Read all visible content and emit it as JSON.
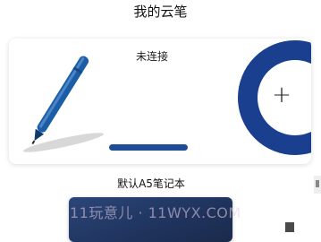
{
  "header": {
    "title": "我的云笔"
  },
  "pen_card": {
    "status": "未连接",
    "add_icon": "plus-icon",
    "pen_icon": "smart-pen-icon",
    "accent_color": "#1a3f8f"
  },
  "notebook": {
    "label": "默认A5笔记本",
    "cover_color": "#23396a"
  },
  "watermark": {
    "text": "11玩意儿 · 11WYX.COM"
  }
}
